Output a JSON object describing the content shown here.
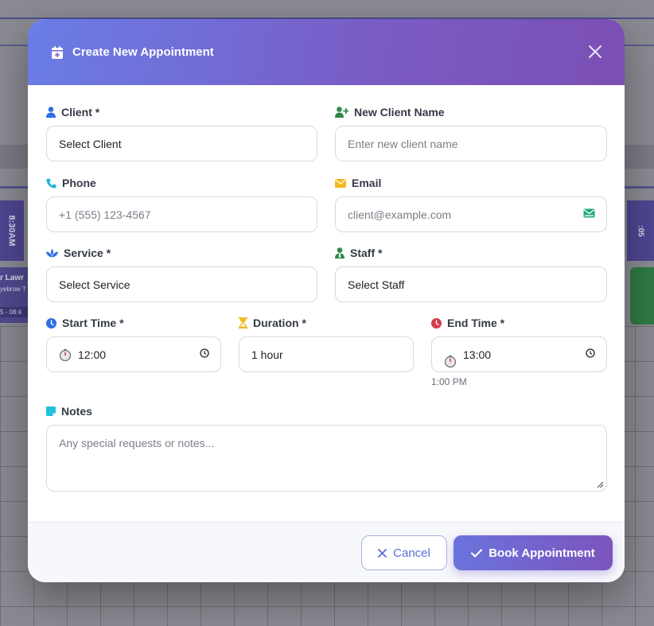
{
  "background": {
    "time_left": "8:30AM",
    "time_right": ":05",
    "appt_name": "r Lawr",
    "appt_service": "yebrow T",
    "appt_time": "5 - 08:4"
  },
  "modal": {
    "title": "Create New Appointment",
    "close_icon": "close-icon"
  },
  "form": {
    "client": {
      "label": "Client *",
      "value": "Select Client"
    },
    "new_client": {
      "label": "New Client Name",
      "placeholder": "Enter new client name"
    },
    "phone": {
      "label": "Phone",
      "placeholder": "+1 (555) 123-4567"
    },
    "email": {
      "label": "Email",
      "placeholder": "client@example.com"
    },
    "service": {
      "label": "Service *",
      "value": "Select Service"
    },
    "staff": {
      "label": "Staff *",
      "value": "Select Staff"
    },
    "start_time": {
      "label": "Start Time *",
      "value": "12:00"
    },
    "duration": {
      "label": "Duration *",
      "value": "1 hour"
    },
    "end_time": {
      "label": "End Time *",
      "value": "13:00",
      "hint": "1:00 PM"
    },
    "notes": {
      "label": "Notes",
      "placeholder": "Any special requests or notes..."
    }
  },
  "footer": {
    "cancel_label": "Cancel",
    "book_label": "Book Appointment"
  },
  "colors": {
    "header_start": "#6a7de6",
    "header_end": "#7b4fb3",
    "accent": "#5b6fd3",
    "client_icon": "#2f6fe4",
    "new_client_icon": "#2f8a4a",
    "phone_icon": "#1fb5d6",
    "email_icon": "#f2b81c",
    "service_icon": "#2f6fe4",
    "staff_icon": "#2f8a4a",
    "start_icon": "#2f6fe4",
    "duration_icon": "#f2b81c",
    "end_icon": "#d93a4a",
    "notes_icon": "#1fc0d8"
  }
}
